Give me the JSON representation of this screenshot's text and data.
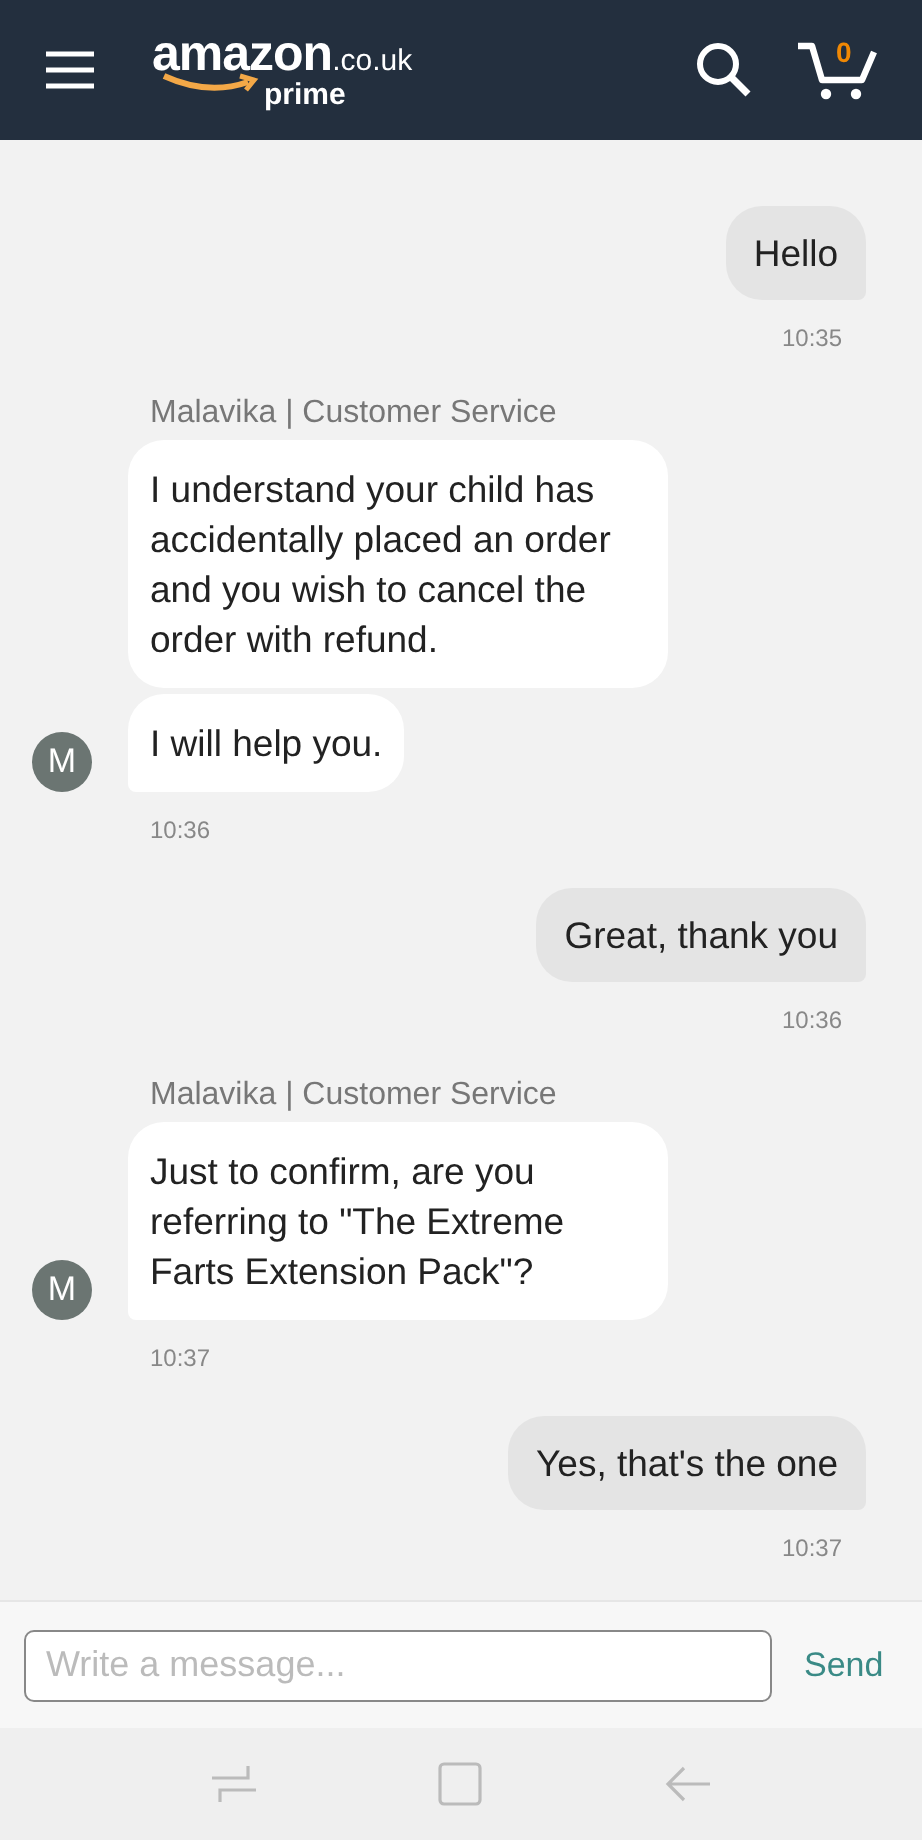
{
  "header": {
    "logo": "amazon",
    "logo_domain": ".co.uk",
    "logo_sub": "prime",
    "cart_count": "0"
  },
  "messages": [
    {
      "kind": "outgoing",
      "bubbles": [
        "Hello"
      ],
      "time": "10:35"
    },
    {
      "kind": "incoming",
      "sender": "Malavika | Customer Service",
      "avatar": "M",
      "bubbles": [
        "I understand your child has accidentally placed an order and you wish to cancel the order with refund.",
        "I will help you."
      ],
      "time": "10:36"
    },
    {
      "kind": "outgoing",
      "bubbles": [
        "Great, thank you"
      ],
      "time": "10:36"
    },
    {
      "kind": "incoming",
      "sender": "Malavika | Customer Service",
      "avatar": "M",
      "bubbles": [
        "Just to confirm, are you referring to \"The Extreme Farts Extension Pack\"?"
      ],
      "time": "10:37"
    },
    {
      "kind": "outgoing",
      "bubbles": [
        "Yes, that's the one"
      ],
      "time": "10:37"
    }
  ],
  "composer": {
    "placeholder": "Write a message...",
    "send": "Send"
  }
}
